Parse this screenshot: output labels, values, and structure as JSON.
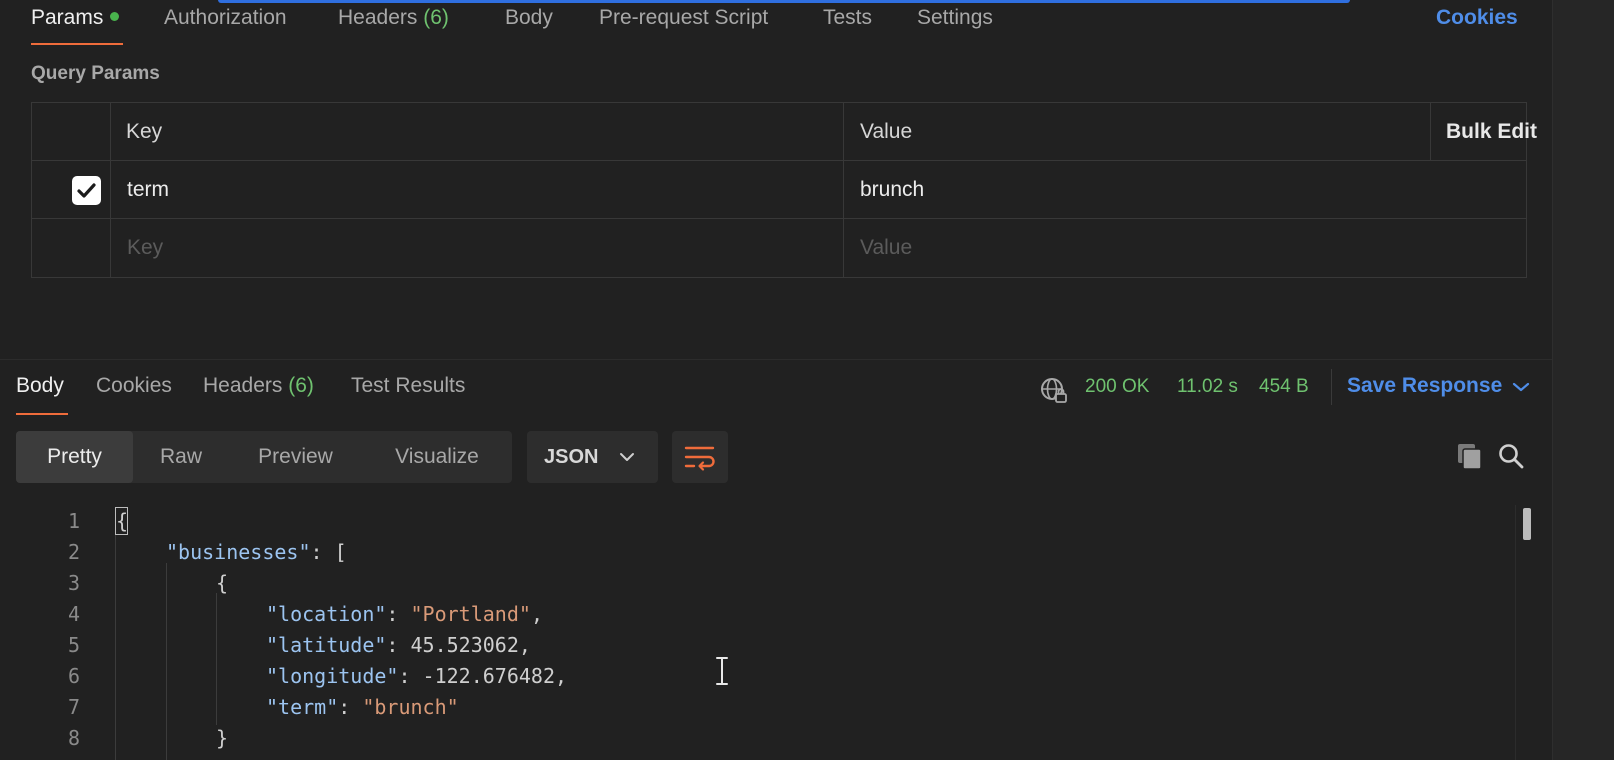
{
  "request_tabs": [
    {
      "label": "Params",
      "count": ""
    },
    {
      "label": "Authorization",
      "count": ""
    },
    {
      "label": "Headers",
      "count": "(6)"
    },
    {
      "label": "Body",
      "count": ""
    },
    {
      "label": "Pre-request Script",
      "count": ""
    },
    {
      "label": "Tests",
      "count": ""
    },
    {
      "label": "Settings",
      "count": ""
    }
  ],
  "cookies_link": "Cookies",
  "query_params": {
    "label": "Query Params",
    "header_key": "Key",
    "header_value": "Value",
    "bulk_edit": "Bulk Edit",
    "rows": [
      {
        "checked": true,
        "key": "term",
        "value": "brunch"
      }
    ],
    "placeholder_key": "Key",
    "placeholder_value": "Value"
  },
  "response_tabs": [
    {
      "label": "Body",
      "count": ""
    },
    {
      "label": "Cookies",
      "count": ""
    },
    {
      "label": "Headers",
      "count": "(6)"
    },
    {
      "label": "Test Results",
      "count": ""
    }
  ],
  "status": {
    "code": "200 OK",
    "time": "11.02 s",
    "size": "454 B"
  },
  "save_response": "Save Response",
  "view_modes": [
    "Pretty",
    "Raw",
    "Preview",
    "Visualize"
  ],
  "format": "JSON",
  "editor": {
    "line_numbers": [
      "1",
      "2",
      "3",
      "4",
      "5",
      "6",
      "7",
      "8"
    ],
    "lines": [
      {
        "open": "{"
      },
      {
        "key": "\"businesses\"",
        "punct": ": ["
      },
      {
        "open": "{"
      },
      {
        "key": "\"location\"",
        "sep": ": ",
        "string": "\"Portland\"",
        "end": ","
      },
      {
        "key": "\"latitude\"",
        "sep": ": ",
        "number": "45.523062",
        "end": ","
      },
      {
        "key": "\"longitude\"",
        "sep": ": ",
        "number": "-122.676482",
        "end": ","
      },
      {
        "key": "\"term\"",
        "sep": ": ",
        "string": "\"brunch\""
      },
      {
        "close": "}"
      }
    ]
  },
  "colors": {
    "accent_orange": "#ef6c3b",
    "link_blue": "#4f8de8",
    "status_green": "#6fc26f",
    "background": "#212121"
  }
}
